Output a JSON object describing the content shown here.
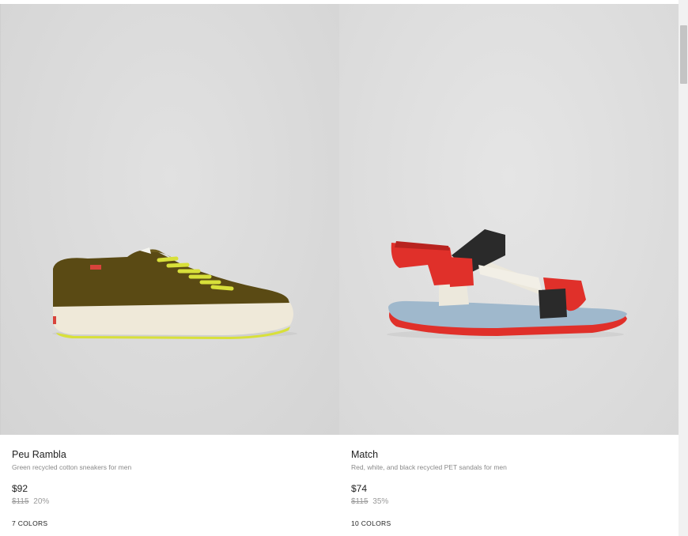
{
  "products": [
    {
      "name": "Peu Rambla",
      "description": "Green recycled cotton sneakers for men",
      "price": "$92",
      "old_price": "$115",
      "discount": "20%",
      "colors": "7 COLORS",
      "image_icon": "green-sneaker-image"
    },
    {
      "name": "Match",
      "description": "Red, white, and black recycled PET sandals for men",
      "price": "$74",
      "old_price": "$115",
      "discount": "35%",
      "colors": "10 COLORS",
      "image_icon": "multicolor-sandal-image"
    }
  ],
  "colors": {
    "sneaker_upper": "#5a4a14",
    "sneaker_laces": "#d8e03a",
    "sneaker_sole": "#efe9d9",
    "sandal_red": "#e0302a",
    "sandal_black": "#2a2a2a",
    "sandal_cream": "#ece8dc",
    "sandal_sole_blue": "#9fb8cc"
  }
}
